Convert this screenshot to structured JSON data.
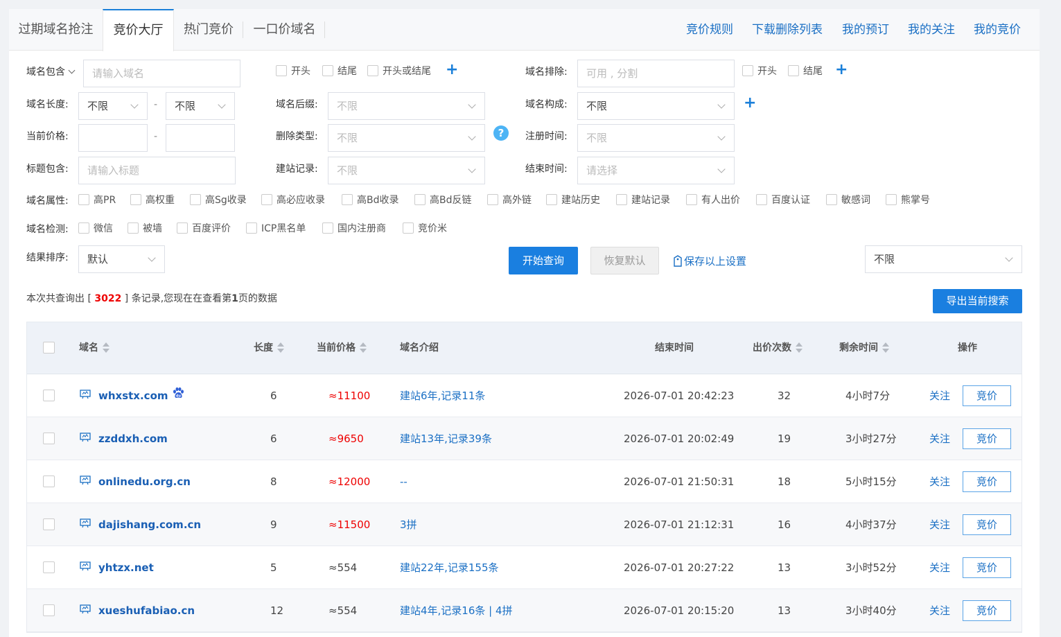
{
  "tabs": [
    {
      "label": "过期域名抢注"
    },
    {
      "label": "竞价大厅"
    },
    {
      "label": "热门竞价"
    },
    {
      "label": "一口价域名"
    }
  ],
  "top_links": [
    "竞价规则",
    "下载删除列表",
    "我的预订",
    "我的关注",
    "我的竞价"
  ],
  "filters": {
    "domain_contains_label": "域名包含",
    "domain_contains_placeholder": "请输入域名",
    "contain_options": [
      "开头",
      "结尾",
      "开头或结尾"
    ],
    "domain_exclude_label": "域名排除:",
    "domain_exclude_placeholder": "可用 , 分割",
    "exclude_options": [
      "开头",
      "结尾"
    ],
    "length_label": "域名长度:",
    "length_min": "不限",
    "length_max": "不限",
    "range_sep": "-",
    "suffix_label": "域名后缀:",
    "suffix_value": "不限",
    "composition_label": "域名构成:",
    "composition_value": "不限",
    "price_label": "当前价格:",
    "delete_type_label": "删除类型:",
    "delete_type_value": "不限",
    "help_mark": "?",
    "reg_time_label": "注册时间:",
    "reg_time_value": "不限",
    "title_label": "标题包含:",
    "title_placeholder": "请输入标题",
    "site_record_label": "建站记录:",
    "site_record_value": "不限",
    "end_time_label": "结束时间:",
    "end_time_placeholder": "请选择",
    "attr_label": "域名属性:",
    "attributes": [
      "高PR",
      "高权重",
      "高Sg收录",
      "高必应收录",
      "高Bd收录",
      "高Bd反链",
      "高外链",
      "建站历史",
      "建站记录",
      "有人出价",
      "百度认证",
      "敏感词",
      "熊掌号"
    ],
    "check_label": "域名检测:",
    "checks": [
      "微信",
      "被墙",
      "百度评价",
      "ICP黑名单",
      "国内注册商",
      "竞价米"
    ],
    "sort_label": "结果排序:",
    "sort_value": "默认",
    "extra_select_value": "不限"
  },
  "actions": {
    "search": "开始查询",
    "reset": "恢复默认",
    "save": "保存以上设置",
    "export": "导出当前搜索"
  },
  "summary": {
    "prefix": "本次共查询出 [",
    "count": "3022",
    "middle": "] 条记录,您现在在查看第",
    "page": "1",
    "suffix": "页的数据"
  },
  "table": {
    "headers": {
      "domain": "域名",
      "length": "长度",
      "price": "当前价格",
      "intro": "域名介绍",
      "end_time": "结束时间",
      "bids": "出价次数",
      "remaining": "剩余时间",
      "ops": "操作"
    },
    "follow_label": "关注",
    "bid_label": "竞价",
    "rows": [
      {
        "domain": "whxstx.com",
        "length": "6",
        "price": "≈11100",
        "price_red": true,
        "intro": "建站6年,记录11条",
        "end": "2026-07-01 20:42:23",
        "bids": "32",
        "remaining": "4小时7分",
        "paw": true
      },
      {
        "domain": "zzddxh.com",
        "length": "6",
        "price": "≈9650",
        "price_red": true,
        "intro": "建站13年,记录39条",
        "end": "2026-07-01 20:02:49",
        "bids": "19",
        "remaining": "3小时27分",
        "paw": false
      },
      {
        "domain": "onlinedu.org.cn",
        "length": "8",
        "price": "≈12000",
        "price_red": true,
        "intro": "--",
        "end": "2026-07-01 21:50:31",
        "bids": "18",
        "remaining": "5小时15分",
        "paw": false
      },
      {
        "domain": "dajishang.com.cn",
        "length": "9",
        "price": "≈11500",
        "price_red": true,
        "intro": "3拼",
        "end": "2026-07-01 21:12:31",
        "bids": "16",
        "remaining": "4小时37分",
        "paw": false
      },
      {
        "domain": "yhtzx.net",
        "length": "5",
        "price": "≈554",
        "price_red": false,
        "intro": "建站22年,记录155条",
        "end": "2026-07-01 20:27:22",
        "bids": "13",
        "remaining": "3小时52分",
        "paw": false
      },
      {
        "domain": "xueshufabiao.cn",
        "length": "12",
        "price": "≈554",
        "price_red": false,
        "intro": "建站4年,记录16条 | 4拼",
        "end": "2026-07-01 20:15:20",
        "bids": "13",
        "remaining": "3小时40分",
        "paw": false
      }
    ]
  }
}
